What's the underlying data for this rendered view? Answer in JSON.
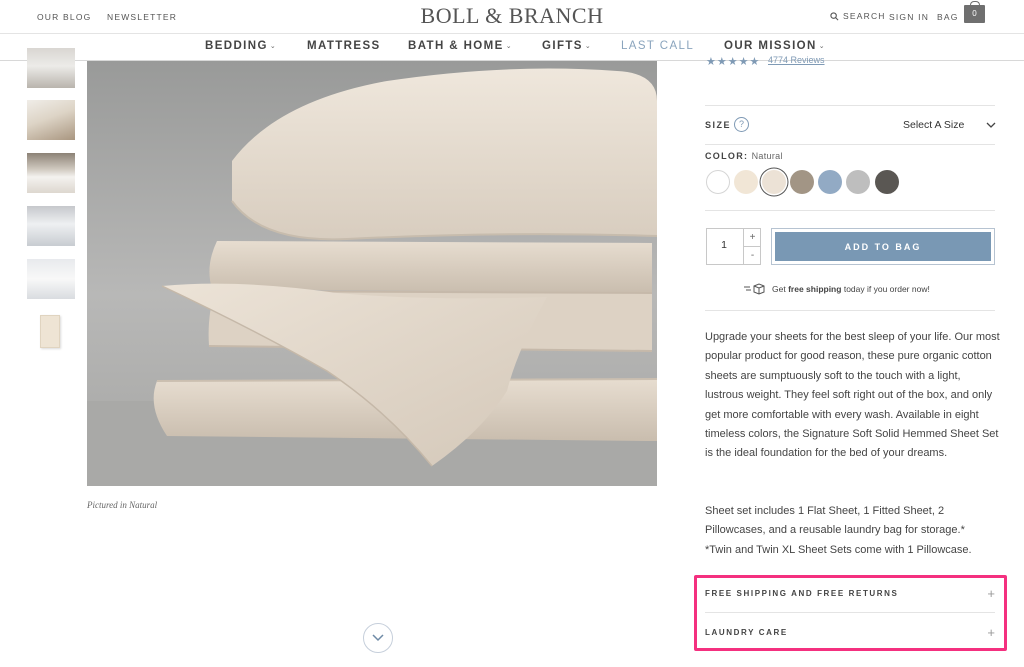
{
  "header": {
    "blog_link": "OUR BLOG",
    "newsletter_link": "NEWSLETTER",
    "logo": "BOLL & BRANCH",
    "search_link": "SEARCH",
    "signin_link": "SIGN IN",
    "bag_link": "BAG",
    "bag_count": "0"
  },
  "nav": {
    "bedding": "BEDDING",
    "mattress": "MATTRESS",
    "bath_home": "BATH & HOME",
    "gifts": "GIFTS",
    "last_call": "LAST CALL",
    "our_mission": "OUR MISSION",
    "accent_color": "#8aa4bd"
  },
  "gallery": {
    "caption": "Pictured in Natural"
  },
  "product": {
    "stars": "★★★★★",
    "reviews": "4774 Reviews",
    "size_label": "SIZE",
    "size_help": "?",
    "size_value": "Select A Size",
    "color_label": "COLOR:",
    "color_value": "Natural",
    "swatches": [
      "#ffffff",
      "#f1e6d6",
      "#ece2d6",
      "#a29585",
      "#92aac4",
      "#bebebe",
      "#5a5753"
    ],
    "quantity": "1",
    "qty_plus": "+",
    "qty_minus": "-",
    "add_to_bag": "ADD TO BAG",
    "ship_prefix": "Get",
    "ship_bold": "free shipping",
    "ship_suffix": "today if you order now!",
    "button_color": "#7998b4"
  },
  "description": {
    "paragraph1": "Upgrade your sheets for the best sleep of your life. Our most popular product for good reason, these pure organic cotton sheets are sumptuously soft to the touch with a light, lustrous weight. They feel soft right out of the box, and only get more comfortable with every wash. Available in eight timeless colors, the Signature Soft Solid Hemmed Sheet Set is the ideal foundation for the bed of your dreams.",
    "paragraph2": "Sheet set includes 1 Flat Sheet, 1 Fitted Sheet, 2 Pillowcases, and a reusable laundry bag for storage.*",
    "paragraph3": "*Twin and Twin XL Sheet Sets come with 1 Pillowcase."
  },
  "accordions": {
    "shipping": "FREE SHIPPING AND FREE RETURNS",
    "laundry": "LAUNDRY CARE",
    "plus": "+",
    "highlight_color": "#f4307f"
  }
}
